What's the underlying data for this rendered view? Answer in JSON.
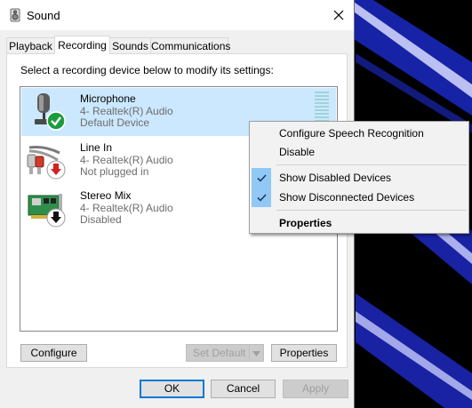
{
  "window": {
    "title": "Sound"
  },
  "tabs": [
    {
      "label": "Playback"
    },
    {
      "label": "Recording"
    },
    {
      "label": "Sounds"
    },
    {
      "label": "Communications"
    }
  ],
  "panel": {
    "instruction": "Select a recording device below to modify its settings:",
    "devices": [
      {
        "name": "Microphone",
        "driver": "4- Realtek(R) Audio",
        "status": "Default Device",
        "selected": true,
        "badge": "green-check"
      },
      {
        "name": "Line In",
        "driver": "4- Realtek(R) Audio",
        "status": "Not plugged in",
        "selected": false,
        "badge": "red-down-arrow"
      },
      {
        "name": "Stereo Mix",
        "driver": "4- Realtek(R) Audio",
        "status": "Disabled",
        "selected": false,
        "badge": "black-down-arrow"
      }
    ],
    "buttons": {
      "configure": "Configure",
      "set_default": "Set Default",
      "properties": "Properties"
    }
  },
  "footer": {
    "ok": "OK",
    "cancel": "Cancel",
    "apply": "Apply"
  },
  "context_menu": {
    "items": [
      {
        "label": "Configure Speech Recognition",
        "checked": false
      },
      {
        "label": "Disable",
        "checked": false
      },
      {
        "label": "Show Disabled Devices",
        "checked": true
      },
      {
        "label": "Show Disconnected Devices",
        "checked": true
      },
      {
        "label": "Properties",
        "checked": false,
        "bold": true
      }
    ]
  },
  "colors": {
    "selection": "#cce8ff",
    "accent": "#0078d7",
    "check_highlight": "#90c8f6",
    "desktop_stripes": "#1e2fd0"
  }
}
